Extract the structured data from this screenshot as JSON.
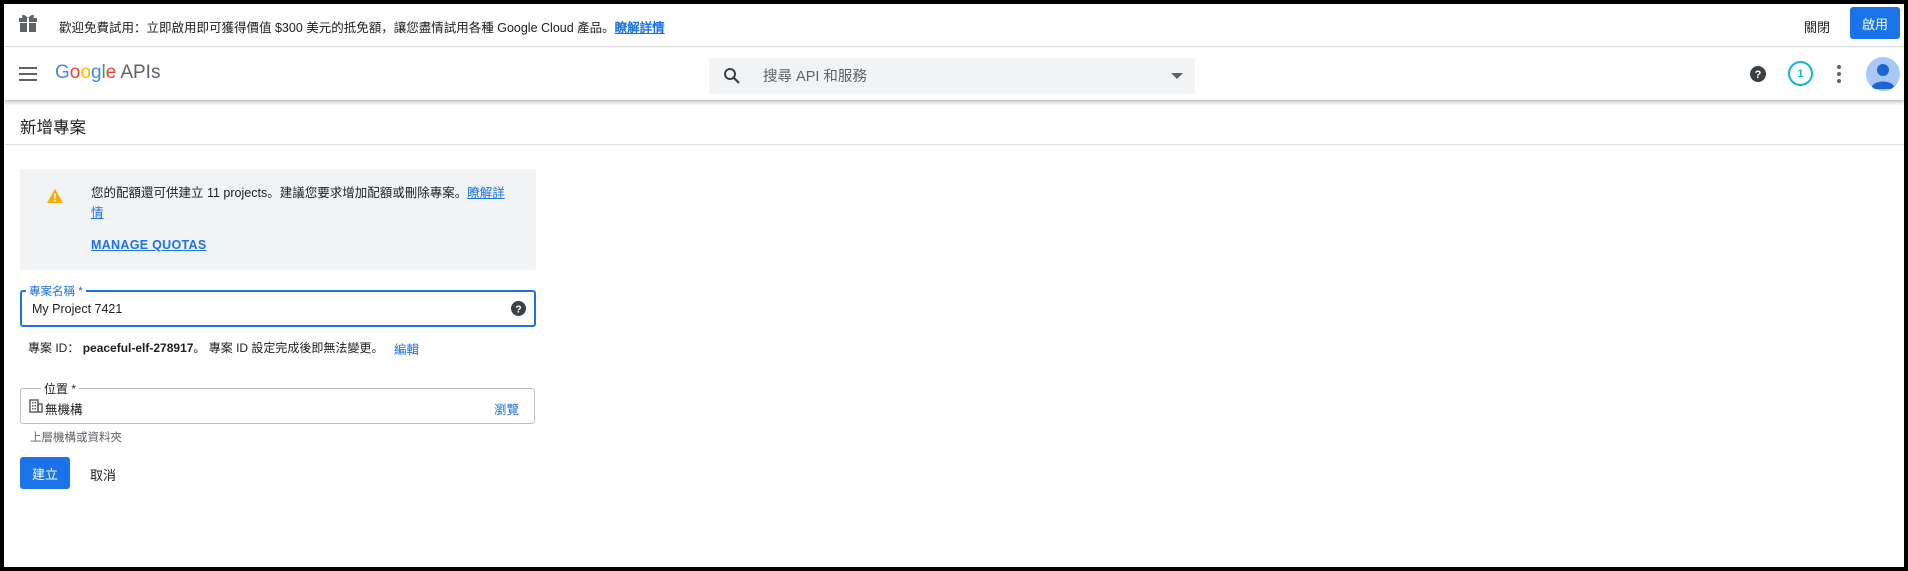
{
  "promo": {
    "text": "歡迎免費試用：立即啟用即可獲得價值 $300 美元的抵免額，讓您盡情試用各種 Google Cloud 產品。",
    "link": "瞭解詳情",
    "dismiss_label": "關閉",
    "activate_label": "啟用"
  },
  "header": {
    "logo_letters": [
      "G",
      "o",
      "o",
      "g",
      "l",
      "e"
    ],
    "logo_colors": [
      "#4285f4",
      "#ea4335",
      "#fbbc05",
      "#4285f4",
      "#34a853",
      "#ea4335"
    ],
    "product": "APIs",
    "search_placeholder": "搜尋 API 和服務",
    "notification_count": "1"
  },
  "page": {
    "title": "新增專案"
  },
  "warning": {
    "text": "您的配額還可供建立 11 projects。建議您要求增加配額或刪除專案。",
    "learn_more": "瞭解詳情",
    "manage_quotas": "MANAGE QUOTAS"
  },
  "project_name": {
    "label": "專案名稱 *",
    "value": "My Project 7421"
  },
  "project_id": {
    "prefix": "專案 ID：",
    "value": "peaceful-elf-278917",
    "suffix": "。 專案 ID 設定完成後即無法變更。",
    "edit_label": "編輯"
  },
  "location": {
    "label": "位置 *",
    "value": "無機構",
    "browse_label": "瀏覽",
    "hint": "上層機構或資料夾"
  },
  "actions": {
    "create_label": "建立",
    "cancel_label": "取消"
  },
  "colors": {
    "primary": "#1a73e8",
    "warning": "#f9ab00",
    "notification": "#12b5cb"
  }
}
